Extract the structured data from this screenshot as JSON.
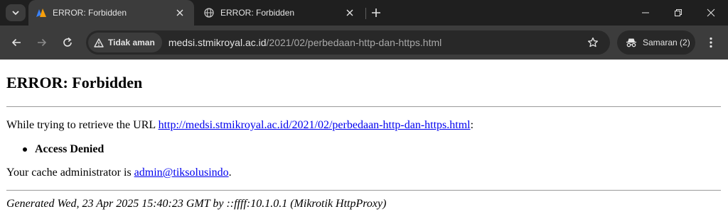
{
  "tabs": [
    {
      "title": "ERROR: Forbidden",
      "active": true
    },
    {
      "title": "ERROR: Forbidden",
      "active": false
    }
  ],
  "toolbar": {
    "security_chip": "Tidak aman",
    "url_host": "medsi.stmikroyal.ac.id",
    "url_path": "/2021/02/perbedaan-http-dan-https.html",
    "incognito_label": "Samaran (2)"
  },
  "page": {
    "heading": "ERROR: Forbidden",
    "retrieve_prefix": "While trying to retrieve the URL ",
    "retrieve_url": "http://medsi.stmikroyal.ac.id/2021/02/perbedaan-http-dan-https.html",
    "retrieve_suffix": ":",
    "bullet": "Access Denied",
    "admin_prefix": "Your cache administrator is ",
    "admin_email": "admin@tiksolusindo",
    "admin_suffix": ".",
    "footer": "Generated Wed, 23 Apr 2025 15:40:23 GMT by ::ffff:10.1.0.1 (Mikrotik HttpProxy)"
  },
  "colors": {
    "tabbar_bg": "#1f1f1f",
    "toolbar_bg": "#3c3c3c",
    "link": "#0000ee"
  },
  "icons": [
    "chevron-down-icon",
    "favicon-icon",
    "globe-icon",
    "close-icon",
    "plus-icon",
    "minimize-icon",
    "restore-icon",
    "window-close-icon",
    "back-arrow-icon",
    "forward-arrow-icon",
    "reload-icon",
    "warning-triangle-icon",
    "star-icon",
    "incognito-icon",
    "kebab-menu-icon"
  ]
}
